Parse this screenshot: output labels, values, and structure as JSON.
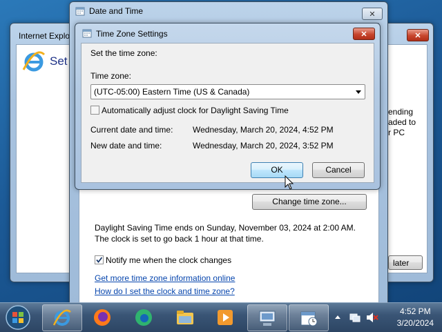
{
  "ie_window": {
    "title": "Internet Explor",
    "heading_partial": "Set u",
    "side_text": [
      "ending",
      "aded to",
      "r PC"
    ],
    "later_button": "later"
  },
  "date_time_window": {
    "title": "Date and Time",
    "change_time_zone_button": "Change time zone...",
    "dst_info": "Daylight Saving Time ends on Sunday, November 03, 2024 at 2:00 AM. The clock is set to go back 1 hour at that time.",
    "notify_label": "Notify me when the clock changes",
    "notify_checked": true,
    "link_more_info": "Get more time zone information online",
    "link_how_to": "How do I set the clock and time zone?"
  },
  "time_zone_dialog": {
    "title": "Time Zone Settings",
    "instruction": "Set the time zone:",
    "time_zone_label": "Time zone:",
    "time_zone_value": "(UTC-05:00) Eastern Time (US & Canada)",
    "dst_checkbox_label": "Automatically adjust clock for Daylight Saving Time",
    "dst_checked": false,
    "current_label": "Current date and time:",
    "current_value": "Wednesday, March 20, 2024, 4:52 PM",
    "new_label": "New date and time:",
    "new_value": "Wednesday, March 20, 2024, 3:52 PM",
    "ok_button": "OK",
    "cancel_button": "Cancel"
  },
  "taskbar": {
    "items": [
      "start-orb",
      "internet-explorer",
      "firefox",
      "edge",
      "file-explorer",
      "media-player",
      "control-panel",
      "date-time"
    ],
    "clock_time": "4:52 PM",
    "clock_date": "3/20/2024"
  }
}
